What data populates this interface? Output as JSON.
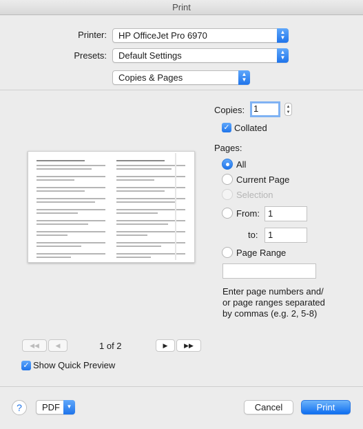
{
  "window": {
    "title": "Print"
  },
  "printer": {
    "label": "Printer:",
    "value": "HP OfficeJet Pro 6970"
  },
  "presets": {
    "label": "Presets:",
    "value": "Default Settings"
  },
  "section": {
    "value": "Copies & Pages"
  },
  "copies": {
    "label": "Copies:",
    "value": "1",
    "collated_label": "Collated",
    "collated": true
  },
  "pages": {
    "label": "Pages:",
    "all": "All",
    "current": "Current Page",
    "selection": "Selection",
    "from_label": "From:",
    "from_value": "1",
    "to_label": "to:",
    "to_value": "1",
    "range_label": "Page Range",
    "range_value": "",
    "hint_line1": "Enter page numbers and/",
    "hint_line2": "or page ranges separated",
    "hint_line3": "by commas (e.g. 2, 5-8)",
    "selected": "All"
  },
  "pager": {
    "text": "1 of 2",
    "first": "◀◀",
    "prev": "◀",
    "next": "▶",
    "last": "▶▶"
  },
  "quick_preview": {
    "label": "Show Quick Preview",
    "checked": true
  },
  "footer": {
    "help": "?",
    "pdf": "PDF",
    "cancel": "Cancel",
    "print": "Print"
  },
  "colors": {
    "accent": "#1f74ea",
    "background": "#ececec"
  }
}
